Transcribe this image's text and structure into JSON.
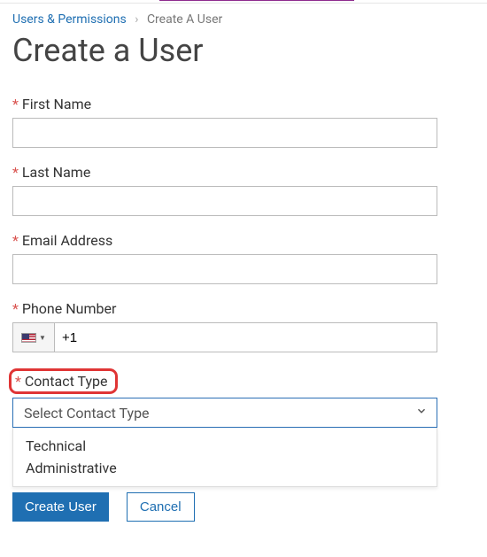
{
  "breadcrumb": {
    "parent": "Users & Permissions",
    "current": "Create A User"
  },
  "page_title": "Create a User",
  "fields": {
    "first_name": {
      "label": "First Name",
      "value": ""
    },
    "last_name": {
      "label": "Last Name",
      "value": ""
    },
    "email": {
      "label": "Email Address",
      "value": ""
    },
    "phone": {
      "label": "Phone Number",
      "value": "+1",
      "country_icon": "us-flag"
    },
    "contact_type": {
      "label": "Contact Type",
      "placeholder": "Select Contact Type",
      "options": [
        "Technical",
        "Administrative"
      ]
    }
  },
  "actions": {
    "primary": "Create User",
    "secondary": "Cancel"
  }
}
